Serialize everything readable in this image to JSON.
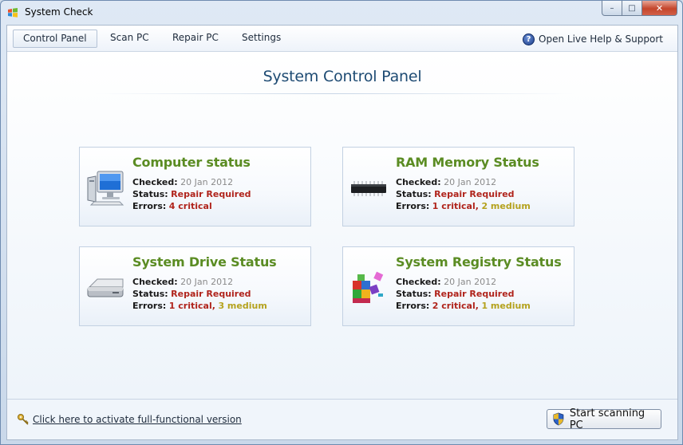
{
  "window": {
    "title": "System Check",
    "controls": {
      "minimize": "–",
      "maximize": "□",
      "close": "✕"
    }
  },
  "menu": {
    "tabs": [
      {
        "label": "Control Panel",
        "active": true
      },
      {
        "label": "Scan PC",
        "active": false
      },
      {
        "label": "Repair PC",
        "active": false
      },
      {
        "label": "Settings",
        "active": false
      }
    ],
    "help_icon": "question-icon",
    "help_label": "Open Live Help & Support"
  },
  "main": {
    "title": "System Control Panel",
    "labels": {
      "checked": "Checked:",
      "status": "Status:",
      "errors": "Errors:"
    },
    "cards": [
      {
        "title": "Computer status",
        "icon": "computer-icon",
        "checked": "20 Jan 2012",
        "status": "Repair Required",
        "critical": "4 critical",
        "sep": "",
        "medium": ""
      },
      {
        "title": "RAM Memory Status",
        "icon": "ram-chip-icon",
        "checked": "20 Jan 2012",
        "status": "Repair Required",
        "critical": "1 critical",
        "sep": ",",
        "medium": "2 medium"
      },
      {
        "title": "System Drive Status",
        "icon": "hard-drive-icon",
        "checked": "20 Jan 2012",
        "status": "Repair Required",
        "critical": "1 critical",
        "sep": ",",
        "medium": "3 medium"
      },
      {
        "title": "System Registry Status",
        "icon": "registry-icon",
        "checked": "20 Jan 2012",
        "status": "Repair Required",
        "critical": "2 critical",
        "sep": ",",
        "medium": "1 medium"
      }
    ]
  },
  "footer": {
    "activate_label": "Click here to activate full-functional version",
    "activate_icon": "key-icon",
    "scan_button": "Start scanning PC",
    "scan_icon": "shield-icon"
  },
  "colors": {
    "title_blue": "#1e4b73",
    "card_title_green": "#5b8c23",
    "status_red": "#b0241c",
    "medium_olive": "#b5a21e"
  }
}
